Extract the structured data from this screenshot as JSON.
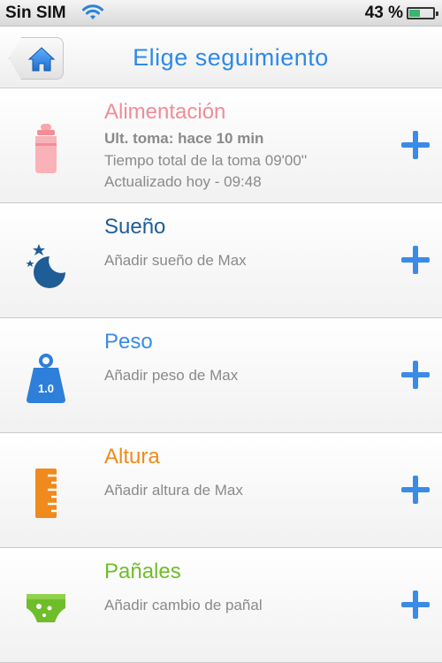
{
  "status_bar": {
    "carrier": "Sin SIM",
    "battery_text": "43 %",
    "battery_level": 0.43
  },
  "nav": {
    "title": "Elige seguimiento",
    "home_icon": "home-icon"
  },
  "items": [
    {
      "title": "Alimentación",
      "color": "#f28b96",
      "icon": "bottle-icon",
      "lines": [
        "Ult. toma: hace 10 min",
        "Tiempo total de la toma 09'00''",
        "Actualizado hoy - 09:48"
      ]
    },
    {
      "title": "Sueño",
      "color": "#1f5d97",
      "icon": "moon-stars-icon",
      "lines": [
        "Añadir sueño de Max"
      ]
    },
    {
      "title": "Peso",
      "color": "#3a8be8",
      "icon": "weight-icon",
      "weight_label": "1.0",
      "lines": [
        "Añadir peso de Max"
      ]
    },
    {
      "title": "Altura",
      "color": "#f08a1c",
      "icon": "ruler-icon",
      "lines": [
        "Añadir altura de Max"
      ]
    },
    {
      "title": "Pañales",
      "color": "#6ebd2b",
      "icon": "diaper-icon",
      "lines": [
        "Añadir cambio de pañal"
      ]
    }
  ]
}
